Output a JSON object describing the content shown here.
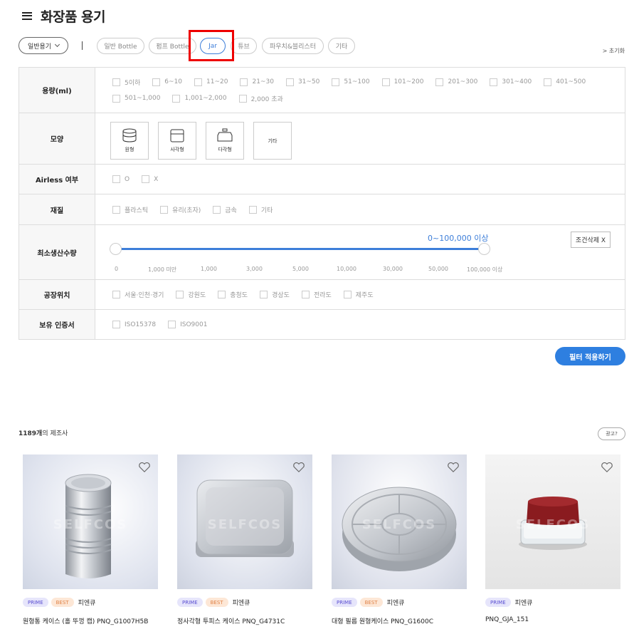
{
  "header": {
    "title": "화장품 용기"
  },
  "category_row": {
    "dropdown_label": "일반용기",
    "chips": [
      "일반 Bottle",
      "펌프 Bottle",
      "Jar",
      "튜브",
      "파우치&블리스터",
      "기타"
    ],
    "active_chip": "Jar",
    "reset_label": "> 초기화"
  },
  "filters": {
    "capacity": {
      "label": "용량(ml)",
      "options": [
        "5이하",
        "6~10",
        "11~20",
        "21~30",
        "31~50",
        "51~100",
        "101~200",
        "201~300",
        "301~400",
        "401~500",
        "501~1,000",
        "1,001~2,000",
        "2,000 초과"
      ]
    },
    "shape": {
      "label": "모양",
      "options": [
        "원형",
        "사각형",
        "다각형",
        "기타"
      ]
    },
    "airless": {
      "label": "Airless 여부",
      "options": [
        "O",
        "X"
      ]
    },
    "material": {
      "label": "재질",
      "options": [
        "플라스틱",
        "유리(초자)",
        "금속",
        "기타"
      ]
    },
    "min_qty": {
      "label": "최소생산수량",
      "value_text": "0~100,000 이상",
      "delete_label": "조건삭제 X",
      "ticks": [
        "0",
        "1,000 미만",
        "1,000",
        "3,000",
        "5,000",
        "10,000",
        "30,000",
        "50,000",
        "100,000 이상"
      ],
      "range_selected": [
        0,
        1
      ]
    },
    "location": {
      "label": "공장위치",
      "options": [
        "서울·인천·경기",
        "강원도",
        "충청도",
        "경상도",
        "전라도",
        "제주도"
      ]
    },
    "certs": {
      "label": "보유 인증서",
      "options": [
        "ISO15378",
        "ISO9001"
      ]
    }
  },
  "apply_label": "필터 적용하기",
  "results": {
    "count": "1189개",
    "suffix": "의 제조사",
    "ad_label": "광고?"
  },
  "watermark": "SELFCOS",
  "products": [
    {
      "tags": [
        "PRIME",
        "BEST"
      ],
      "maker": "피엔큐",
      "name": "원형통 케이스 (홀 뚜껑 캡) PNQ_G1007H5B"
    },
    {
      "tags": [
        "PRIME",
        "BEST"
      ],
      "maker": "피엔큐",
      "name": "정사각형 투피스 케이스 PNQ_G4731C"
    },
    {
      "tags": [
        "PRIME",
        "BEST"
      ],
      "maker": "피엔큐",
      "name": "대형 필름 원형케이스 PNQ_G1600C"
    },
    {
      "tags": [
        "PRIME"
      ],
      "maker": "피엔큐",
      "name": "PNQ_GJA_151"
    }
  ],
  "colors": {
    "accent": "#3d7ed9",
    "button": "#2e7fe0",
    "highlight": "#ee0000"
  }
}
